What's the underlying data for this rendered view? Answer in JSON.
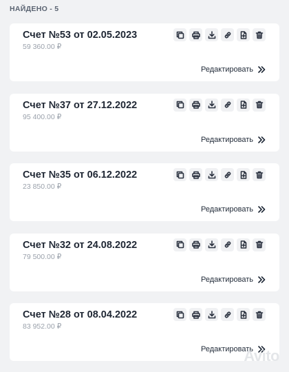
{
  "found_label": "НАЙДЕНО - 5",
  "edit_label": "Редактировать",
  "watermark": "Avito",
  "invoices": [
    {
      "title": "Счет №53 от 02.05.2023",
      "amount": "59 360.00 ₽"
    },
    {
      "title": "Счет №37 от 27.12.2022",
      "amount": "95 400.00 ₽"
    },
    {
      "title": "Счет №35 от 06.12.2022",
      "amount": "23 850.00 ₽"
    },
    {
      "title": "Счет №32 от 24.08.2022",
      "amount": "79 500.00 ₽"
    },
    {
      "title": "Счет №28 от 08.04.2022",
      "amount": "83 952.00 ₽"
    }
  ],
  "action_icons": [
    "copy-icon",
    "print-icon",
    "download-icon",
    "link-icon",
    "add-file-icon",
    "delete-icon"
  ]
}
